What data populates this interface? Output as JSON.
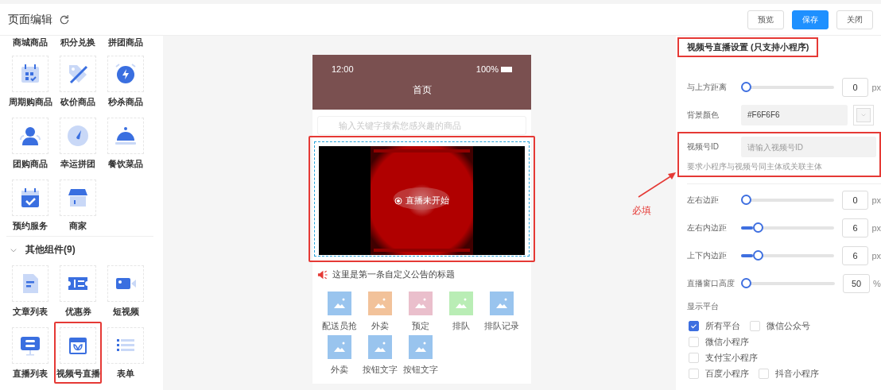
{
  "header": {
    "title": "页面编辑",
    "buttons": [
      {
        "label": "预览",
        "kind": "default"
      },
      {
        "label": "保存",
        "kind": "primary"
      },
      {
        "label": "关闭",
        "kind": "default"
      }
    ]
  },
  "component_panel": {
    "cut_off_labels": [
      "商城商品",
      "积分兑换",
      "拼团商品"
    ],
    "items": [
      {
        "label": "周期购商品",
        "selected": false
      },
      {
        "label": "砍价商品",
        "selected": false
      },
      {
        "label": "秒杀商品",
        "selected": false
      },
      {
        "label": "团购商品",
        "selected": false
      },
      {
        "label": "幸运拼团",
        "selected": false
      },
      {
        "label": "餐饮菜品",
        "selected": false
      },
      {
        "label": "预约服务",
        "selected": false
      },
      {
        "label": "商家",
        "selected": false
      }
    ],
    "section": {
      "title": "其他组件(9)",
      "expanded": true,
      "items": [
        {
          "label": "文章列表",
          "selected": false
        },
        {
          "label": "优惠券",
          "selected": false
        },
        {
          "label": "短视频",
          "selected": false
        },
        {
          "label": "直播列表",
          "selected": false
        },
        {
          "label": "视频号直播",
          "selected": true
        },
        {
          "label": "表单",
          "selected": false
        }
      ]
    }
  },
  "phone": {
    "time": "12:00",
    "battery": "100%",
    "page_title": "首页",
    "search_placeholder": "输入关键字搜索您感兴趣的商品",
    "live": {
      "status": "直播未开始",
      "selected": true
    },
    "notice": "这里是第一条自定义公告的标题",
    "nav_items": [
      {
        "label": "配送员抢",
        "color": "#99c4ee"
      },
      {
        "label": "外卖",
        "color": "#f2c29a"
      },
      {
        "label": "预定",
        "color": "#eabfcc"
      },
      {
        "label": "排队",
        "color": "#b9edb5"
      },
      {
        "label": "排队记录",
        "color": "#99c4ee"
      },
      {
        "label": "外卖",
        "color": "#99c4ee"
      },
      {
        "label": "按钮文字",
        "color": "#99c4ee"
      },
      {
        "label": "按钮文字",
        "color": "#99c4ee"
      }
    ]
  },
  "annotation": {
    "text": "必填"
  },
  "settings": {
    "title": {
      "text": "视频号直播设置 (只支持小程序)",
      "highlighted": true
    },
    "rows": [
      {
        "kind": "slider",
        "label": "与上方距离",
        "level": 0,
        "value": "0",
        "unit": "px"
      },
      {
        "kind": "color",
        "label": "背景颜色",
        "value": "#F6F6F6"
      },
      {
        "kind": "text",
        "label": "视频号ID",
        "placeholder": "请输入视频号ID",
        "hint": "要求小程序与视频号同主体或关联主体",
        "highlighted": true
      },
      {
        "kind": "slider",
        "label": "左右边距",
        "level": 0,
        "value": "0",
        "unit": "px"
      },
      {
        "kind": "slider",
        "label": "左右内边距",
        "level": 0.15,
        "value": "6",
        "unit": "px"
      },
      {
        "kind": "slider",
        "label": "上下内边距",
        "level": 0.15,
        "value": "6",
        "unit": "px"
      },
      {
        "kind": "slider",
        "label": "直播窗口高度",
        "level": 0,
        "value": "50",
        "unit": "%"
      }
    ],
    "platforms": {
      "label": "显示平台",
      "rows": [
        {
          "options": [
            {
              "label": "所有平台",
              "checked": true
            },
            {
              "label": "微信公众号",
              "checked": false
            }
          ]
        },
        {
          "options": [
            {
              "label": "微信小程序",
              "checked": false
            }
          ]
        },
        {
          "options": [
            {
              "label": "支付宝小程序",
              "checked": false
            }
          ]
        },
        {
          "options": [
            {
              "label": "百度小程序",
              "checked": false
            },
            {
              "label": "抖音小程序",
              "checked": false
            }
          ]
        }
      ]
    }
  }
}
